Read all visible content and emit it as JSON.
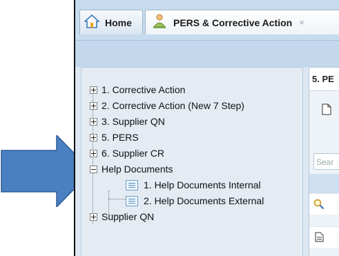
{
  "tabs": [
    {
      "label": "Home",
      "icon": "home-icon"
    },
    {
      "label": "PERS & Corrective Action",
      "icon": "people-icon",
      "close": "×"
    }
  ],
  "right_panel": {
    "title": "5. PE",
    "search_placeholder": "Sear"
  },
  "tree": {
    "items": [
      {
        "label": "1. Corrective Action",
        "state": "collapsed"
      },
      {
        "label": "2. Corrective Action (New 7 Step)",
        "state": "collapsed"
      },
      {
        "label": "3. Supplier QN",
        "state": "collapsed"
      },
      {
        "label": "5. PERS",
        "state": "collapsed"
      },
      {
        "label": "6. Supplier CR",
        "state": "collapsed"
      },
      {
        "label": "Help Documents",
        "state": "expanded",
        "children": [
          {
            "label": "1. Help Documents Internal"
          },
          {
            "label": "2. Help Documents External"
          }
        ]
      },
      {
        "label": "Supplier QN",
        "state": "collapsed"
      }
    ]
  },
  "annotation": {
    "icon": "arrow-right-icon",
    "color": "#4a7fc1"
  }
}
